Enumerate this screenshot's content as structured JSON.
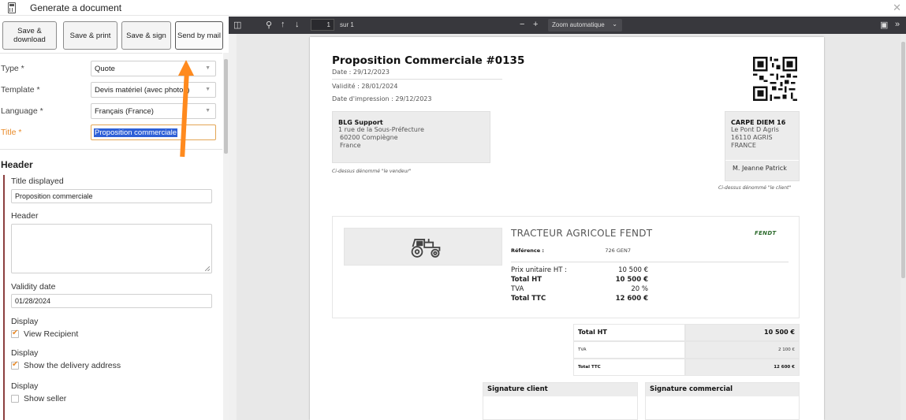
{
  "window": {
    "title": "Generate a document"
  },
  "actions": {
    "save_download": "Save & download",
    "save_print": "Save & print",
    "save_sign": "Save & sign",
    "send_mail": "Send by mail"
  },
  "form": {
    "type": {
      "label": "Type *",
      "value": "Quote"
    },
    "template": {
      "label": "Template *",
      "value": "Devis matériel (avec photos)"
    },
    "language": {
      "label": "Language *",
      "value": "Français (France)"
    },
    "title": {
      "label": "Title *",
      "value": "Proposition commerciale"
    }
  },
  "header_section": {
    "heading": "Header",
    "title_displayed_label": "Title displayed",
    "title_displayed_value": "Proposition commerciale",
    "header_label": "Header",
    "validity_label": "Validity date",
    "validity_value": "01/28/2024",
    "display1_label": "Display",
    "display1_option": "View Recipient",
    "display1_checked": true,
    "display2_label": "Display",
    "display2_option": "Show the delivery address",
    "display2_checked": true,
    "display3_label": "Display",
    "display3_option": "Show seller",
    "display3_checked": false
  },
  "viewer": {
    "page_number": "1",
    "page_total": "sur 1",
    "zoom": "Zoom automatique"
  },
  "document": {
    "title": "Proposition Commerciale #0135",
    "date": "Date : 29/12/2023",
    "validity": "Validité : 28/01/2024",
    "print_date": "Date d'impression : 29/12/2023",
    "seller": {
      "name": "BLG Support",
      "line1": "1 rue de la Sous-Préfecture",
      "line2": "60200 Compiègne",
      "line3": "France",
      "note": "Ci-dessus dénommé \"le vendeur\""
    },
    "client": {
      "name": "CARPE DIEM 16",
      "line1": "Le Pont D Agris",
      "line2": "16110 AGRIS",
      "line3": "FRANCE",
      "contact": "M. Jeanne Patrick",
      "note": "Ci-dessus dénommé \"le client\""
    },
    "product": {
      "title": "TRACTEUR AGRICOLE FENDT",
      "brand": "FENDT",
      "ref_label": "Référence :",
      "ref_value": "726 GEN7",
      "unit_price_label": "Prix unitaire HT :",
      "unit_price_value": "10 500 €",
      "total_ht_label": "Total HT",
      "total_ht_value": "10 500 €",
      "tva_label": "TVA",
      "tva_value": "20 %",
      "total_ttc_label": "Total TTC",
      "total_ttc_value": "12 600 €"
    },
    "totals": {
      "total_ht_label": "Total HT",
      "total_ht_value": "10 500 €",
      "tva_label": "TVA",
      "tva_value": "2 100 €",
      "total_ttc_label": "Total TTC",
      "total_ttc_value": "12 600 €"
    },
    "signature_client": "Signature client",
    "signature_commercial": "Signature commercial"
  },
  "colors": {
    "accent": "#ff8a1e",
    "warning_label": "#e98b2a",
    "section_bar": "#8c3f3f",
    "viewer_toolbar": "#38383d"
  }
}
